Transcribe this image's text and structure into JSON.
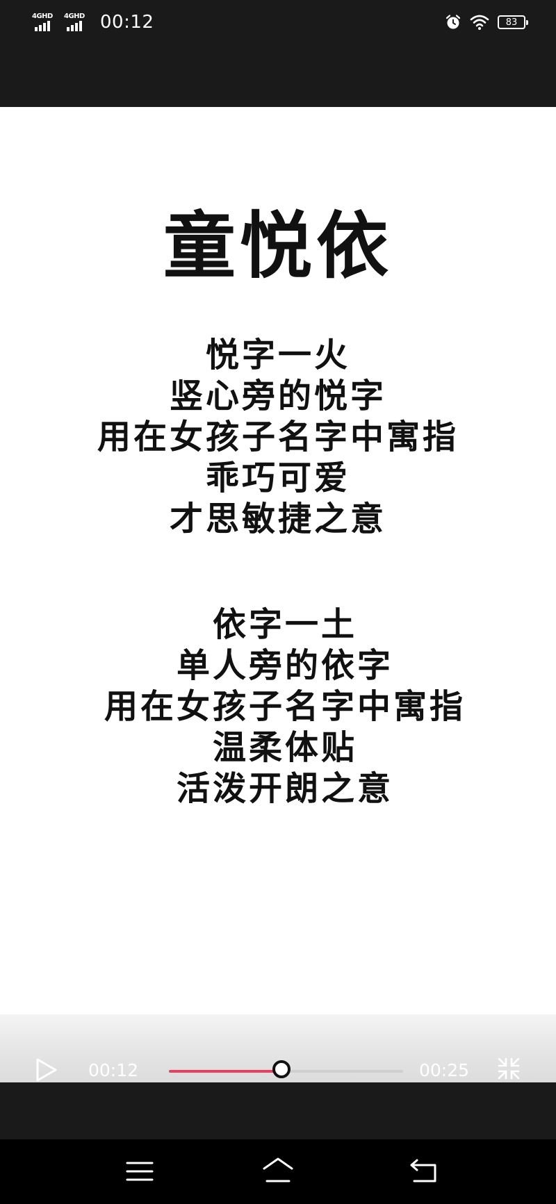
{
  "status_bar": {
    "network_1": "4GHD",
    "network_2": "4GHD",
    "time": "00:12",
    "battery": "83",
    "icons": [
      "signal-icon",
      "signal-icon",
      "alarm-icon",
      "wifi-icon",
      "battery-icon"
    ]
  },
  "content": {
    "title": "童悦依",
    "poem_1": [
      "悦字一火",
      "竖心旁的悦字",
      "用在女孩子名字中寓指",
      "乖巧可爱",
      "才思敏捷之意"
    ],
    "poem_2": [
      "依字一土",
      "单人旁的依字",
      "用在女孩子名字中寓指",
      "温柔体贴",
      "活泼开朗之意"
    ]
  },
  "player": {
    "current_time": "00:12",
    "total_time": "00:25",
    "progress": 0.48,
    "progress_color": "#e8405f",
    "icons": [
      "play-icon",
      "exit-fullscreen-icon"
    ]
  },
  "nav_bar": {
    "icons": [
      "menu-icon",
      "home-icon",
      "back-icon"
    ]
  }
}
